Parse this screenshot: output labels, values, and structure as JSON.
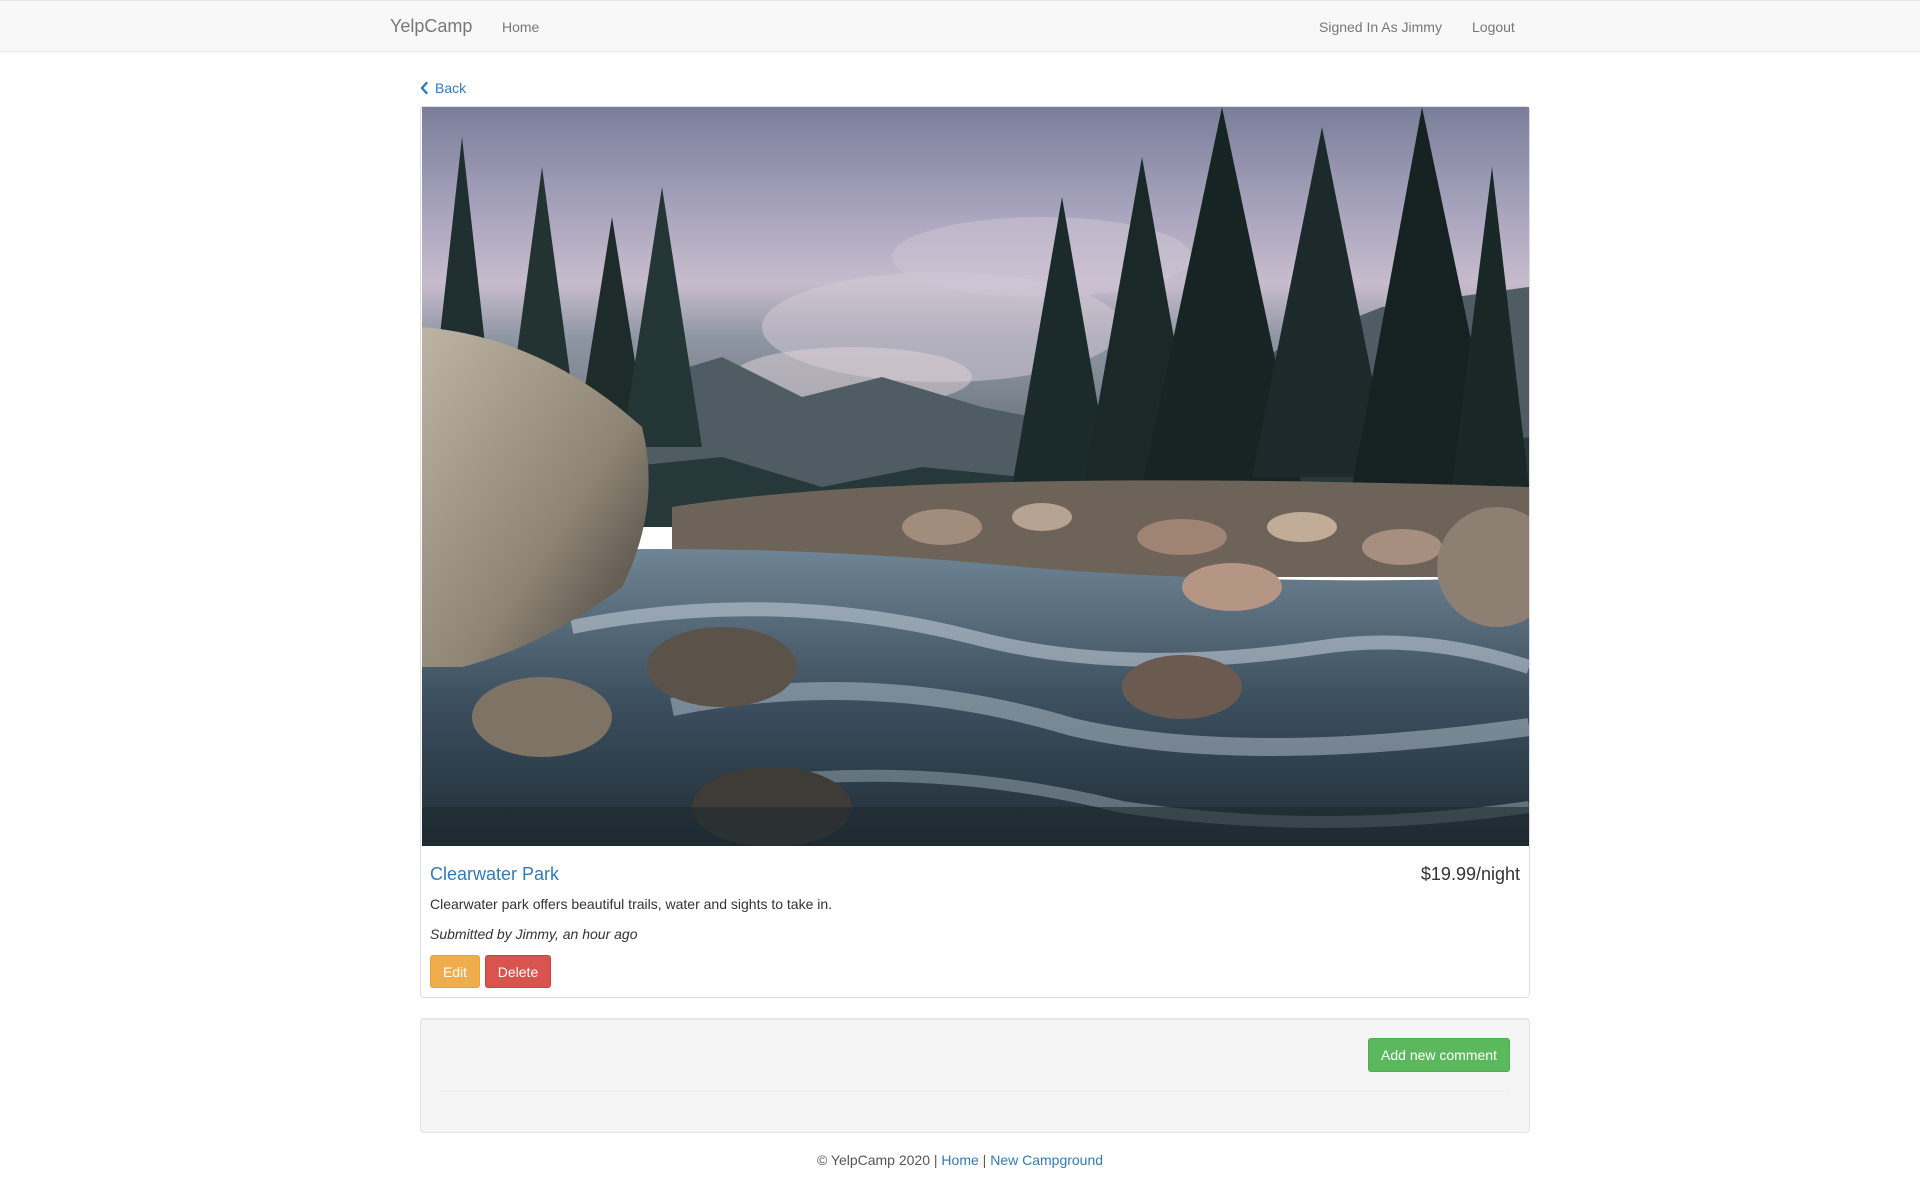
{
  "navbar": {
    "brand": "YelpCamp",
    "home": "Home",
    "signed_in": "Signed In As Jimmy",
    "logout": "Logout"
  },
  "back": {
    "label": "Back",
    "icon": "chevron-left-icon"
  },
  "campground": {
    "image_alt": "river-landscape-photo",
    "name": "Clearwater Park",
    "price": "$19.99/night",
    "description": "Clearwater park offers beautiful trails, water and sights to take in.",
    "submitted": "Submitted by Jimmy, an hour ago",
    "edit_label": "Edit",
    "delete_label": "Delete"
  },
  "comments": {
    "add_label": "Add new comment"
  },
  "footer": {
    "copyright": "© YelpCamp 2020 |",
    "home": "Home",
    "separator": "|",
    "new_campground": "New Campground"
  },
  "colors": {
    "link": "#337ab7",
    "warning": "#f0ad4e",
    "danger": "#d9534f",
    "success": "#5cb85c",
    "navbar_bg": "#f8f8f8"
  }
}
